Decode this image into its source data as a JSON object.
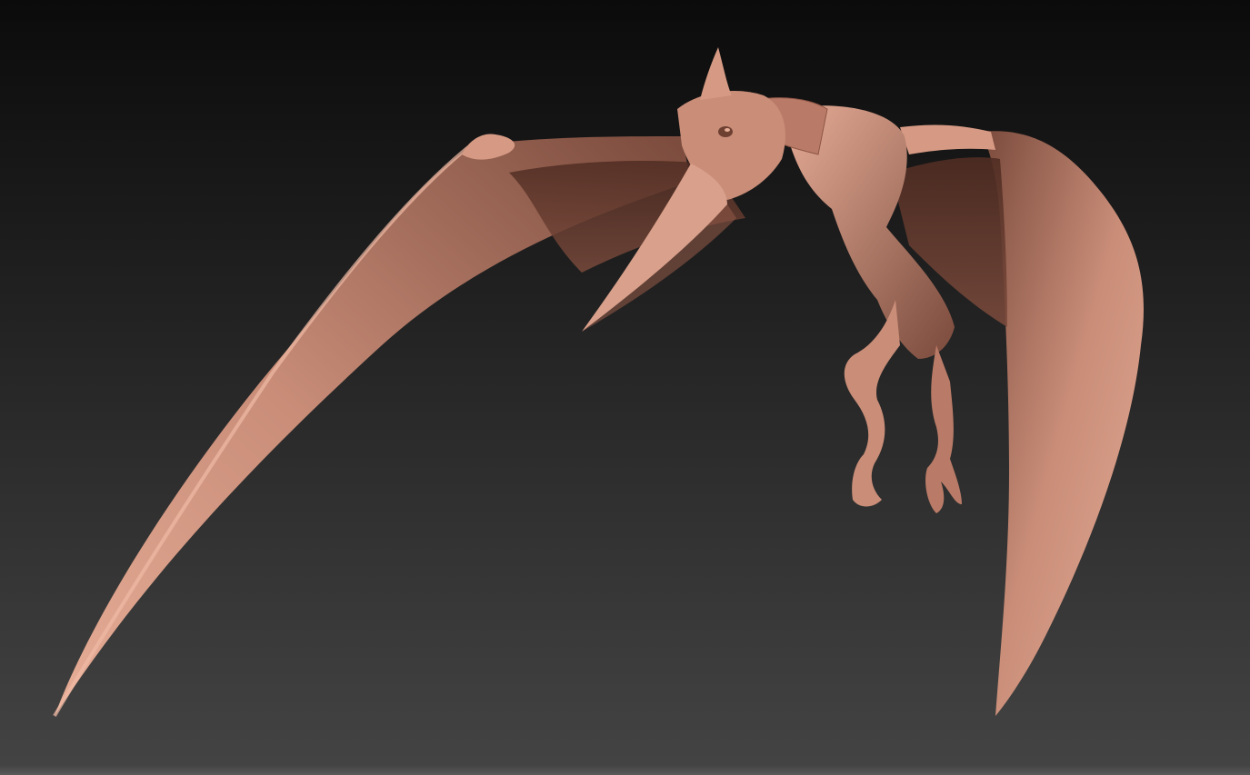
{
  "viewport": {
    "background_top": "#0b0b0b",
    "background_bottom": "#444444",
    "edge_color": "#5a5a5a"
  },
  "model": {
    "subject": "pterosaur-sculpt",
    "material_base": "#c98d78",
    "material_light": "#e6ad97",
    "material_shadow": "#7a4a3c",
    "material_deep": "#4f2c22"
  }
}
